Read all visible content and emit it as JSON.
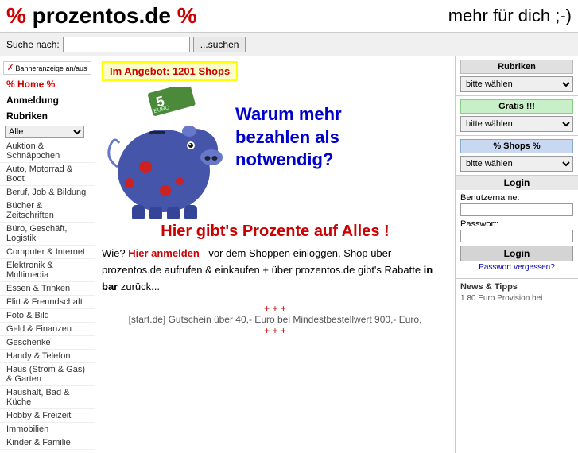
{
  "header": {
    "logo_percent1": "%",
    "logo_text": " prozentos.de ",
    "logo_percent2": "%",
    "tagline": "mehr für dich ;-)"
  },
  "searchbar": {
    "label": "Suche nach:",
    "placeholder": "",
    "button_label": "...suchen"
  },
  "sidebar": {
    "banner_toggle": "Banneranzeige an/aus",
    "home_link": "% Home %",
    "anmeldung_label": "Anmeldung",
    "rubrik_label": "Rubriken",
    "rubrik_option": "Alle",
    "nav_items": [
      "Auktion & Schnäppchen",
      "Auto, Motorrad & Boot",
      "Beruf, Job & Bildung",
      "Bücher & Zeitschriften",
      "Büro, Geschäft, Logistik",
      "Computer & Internet",
      "Elektronik & Multimedia",
      "Essen & Trinken",
      "Flirt & Freundschaft",
      "Foto & Bild",
      "Geld & Finanzen",
      "Geschenke",
      "Handy & Telefon",
      "Haus (Strom & Gas) & Garten",
      "Haushalt, Bad & Küche",
      "Hobby & Freizeit",
      "Immobilien",
      "Kinder & Familie"
    ]
  },
  "offer_banner": "Im Angebot: 1201 Shops",
  "why_text": "Warum mehr\nbezahlen als\nnotwendig?",
  "main_slogan": "Hier gibt's Prozente auf Alles !",
  "description": {
    "prefix": "Wie? ",
    "link": "Hier anmelden",
    "suffix": " - vor dem Shoppen einloggen, Shop über prozentos.de aufrufen & einkaufen + über prozentos.de gibt's Rabatte ",
    "bold": "in bar",
    "end": " zurück..."
  },
  "voucher": {
    "plus1": "+ + +",
    "text": "[start.de] Gutschein über 40,- Euro bei Mindestbestellwert 900,- Euro,",
    "plus2": "+ + +"
  },
  "right_panel": {
    "rubrik_title": "Rubriken",
    "rubrik_option": "bitte wählen",
    "gratis_title": "Gratis !!!",
    "gratis_option": "bitte wählen",
    "shops_title": "% Shops %",
    "shops_option": "bitte wählen"
  },
  "login": {
    "title": "Login",
    "username_label": "Benutzername:",
    "password_label": "Passwort:",
    "button_label": "Login",
    "forgot_label": "Passwort vergessen?"
  },
  "news": {
    "title": "News & Tipps",
    "content": "1.80 Euro Provision bei"
  }
}
